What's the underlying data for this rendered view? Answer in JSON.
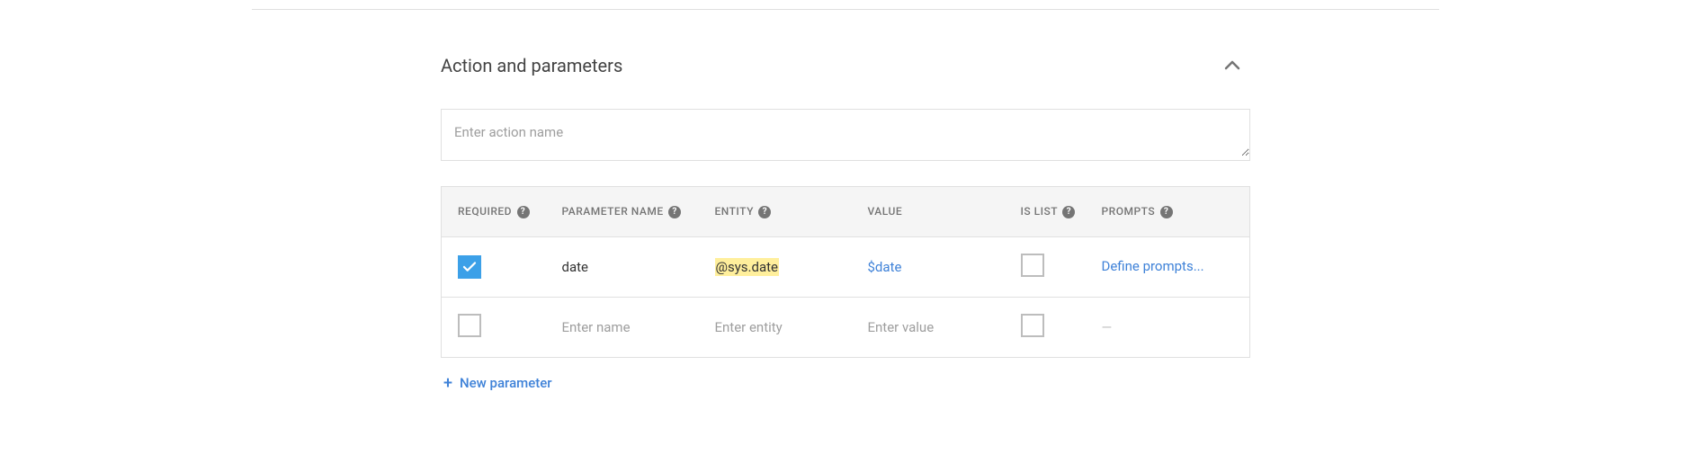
{
  "section": {
    "title": "Action and parameters"
  },
  "action_input": {
    "placeholder": "Enter action name",
    "value": ""
  },
  "table": {
    "headers": {
      "required": "REQUIRED",
      "parameter_name": "PARAMETER NAME",
      "entity": "ENTITY",
      "value": "VALUE",
      "is_list": "IS LIST",
      "prompts": "PROMPTS"
    },
    "rows": [
      {
        "required": true,
        "name": "date",
        "entity": "@sys.date",
        "value": "$date",
        "is_list": false,
        "prompts_link": "Define prompts..."
      }
    ],
    "new_row": {
      "name_placeholder": "Enter name",
      "entity_placeholder": "Enter entity",
      "value_placeholder": "Enter value",
      "prompts_dash": "—"
    }
  },
  "add_parameter": {
    "label": "New parameter",
    "plus": "+"
  },
  "help_icon_glyph": "?"
}
